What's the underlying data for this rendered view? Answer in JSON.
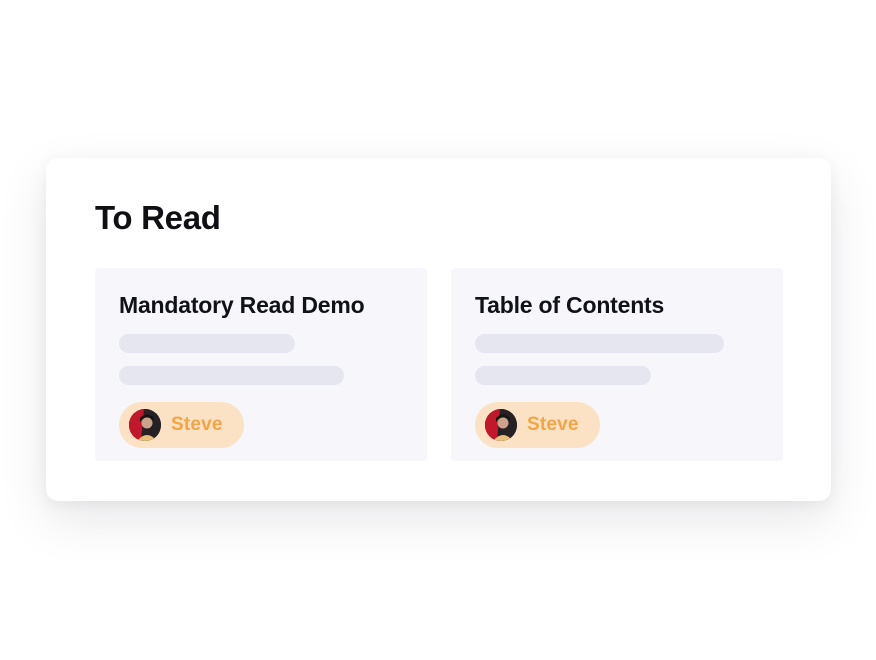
{
  "section": {
    "title": "To Read"
  },
  "cards": [
    {
      "title": "Mandatory Read Demo",
      "assignee": {
        "name": "Steve",
        "avatar_icon": "user-avatar-photo"
      }
    },
    {
      "title": "Table of Contents",
      "assignee": {
        "name": "Steve",
        "avatar_icon": "user-avatar-photo"
      }
    }
  ],
  "colors": {
    "card_background": "#f6f6fb",
    "placeholder_line": "#e6e6f0",
    "chip_background": "#fbe2c5",
    "chip_text": "#f5a443",
    "title_text": "#0f0f14"
  }
}
